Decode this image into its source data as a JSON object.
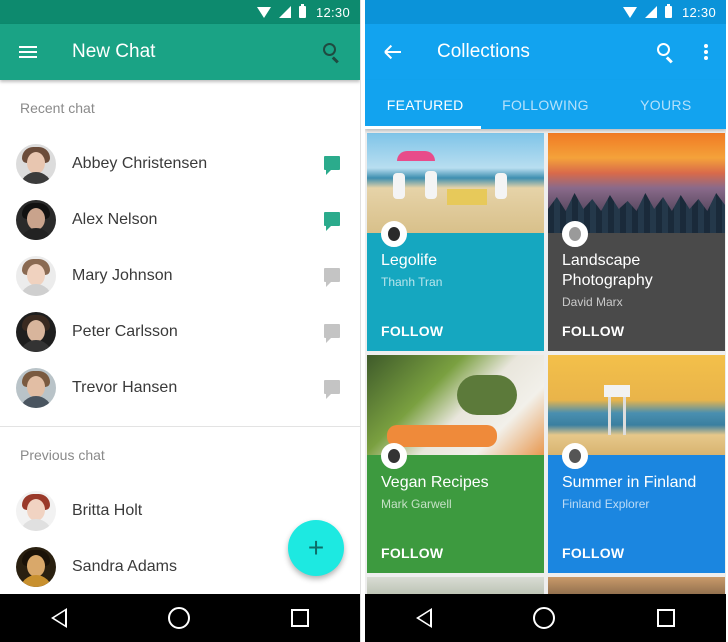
{
  "status_bar": {
    "time": "12:30"
  },
  "left": {
    "appbar": {
      "title": "New Chat"
    },
    "recent_label": "Recent chat",
    "recent": [
      {
        "name": "Abbey Christensen",
        "unread": true
      },
      {
        "name": "Alex Nelson",
        "unread": true
      },
      {
        "name": "Mary Johnson",
        "unread": false
      },
      {
        "name": "Peter Carlsson",
        "unread": false
      },
      {
        "name": "Trevor Hansen",
        "unread": false
      }
    ],
    "previous_label": "Previous chat",
    "previous": [
      {
        "name": "Britta Holt"
      },
      {
        "name": "Sandra Adams"
      }
    ],
    "fab_label": "+"
  },
  "right": {
    "appbar": {
      "title": "Collections"
    },
    "tabs": [
      "FEATURED",
      "FOLLOWING",
      "YOURS"
    ],
    "cards": [
      {
        "title": "Legolife",
        "author": "Thanh Tran",
        "action": "FOLLOW",
        "color": "#15a7c0"
      },
      {
        "title": "Landscape Photography",
        "author": "David Marx",
        "action": "FOLLOW",
        "color": "#4a4a4a"
      },
      {
        "title": "Vegan Recipes",
        "author": "Mark Garwell",
        "action": "FOLLOW",
        "color": "#3d9a3f"
      },
      {
        "title": "Summer in Finland",
        "author": "Finland Explorer",
        "action": "FOLLOW",
        "color": "#1b86e0"
      }
    ]
  },
  "colors": {
    "left_primary": "#1aa385",
    "right_primary": "#12a3ef",
    "fab": "#1de9e1"
  }
}
